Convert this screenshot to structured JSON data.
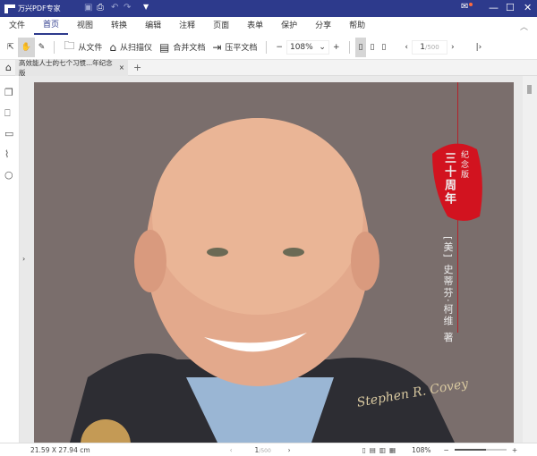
{
  "app": {
    "title": "万兴PDF专家"
  },
  "menu": [
    "文件",
    "首页",
    "视图",
    "转换",
    "编辑",
    "注释",
    "页面",
    "表单",
    "保护",
    "分享",
    "帮助"
  ],
  "toolbar": {
    "from_file": "从文件",
    "from_scanner": "从扫描仪",
    "merge": "合并文档",
    "flatten": "压平文档",
    "zoom": "108%",
    "page_current": "1",
    "page_total": "/500"
  },
  "tab": {
    "label": "高效能人士的七个习惯...年纪念版"
  },
  "cover": {
    "seal_main": "三十周年",
    "seal_small": "纪念版",
    "author": "[美] 史蒂芬·柯维 著",
    "signature": "Stephen R. Covey"
  },
  "status": {
    "size": "21.59 X 27.94 cm",
    "page_current": "1",
    "page_total": "/500",
    "zoom": "108%"
  }
}
